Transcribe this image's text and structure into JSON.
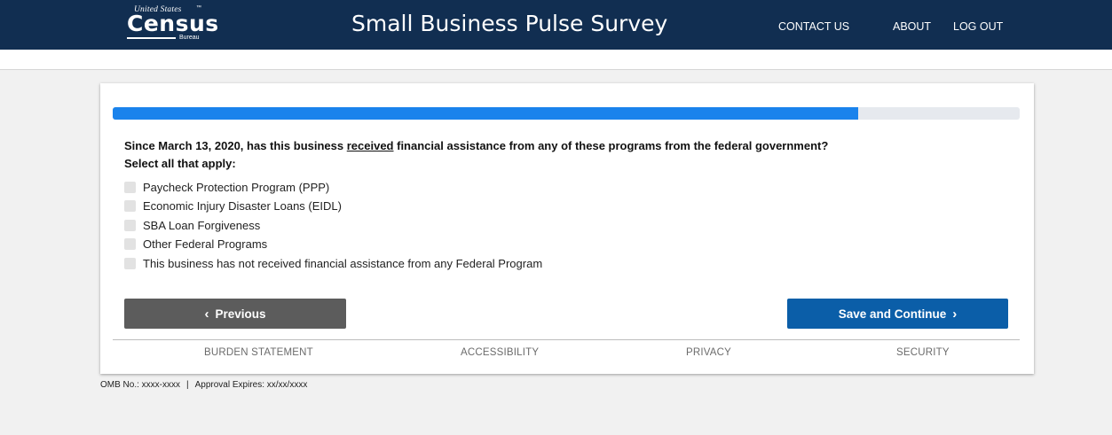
{
  "header": {
    "logo": {
      "top": "United States",
      "tm": "™",
      "main": "Census",
      "bottom": "Bureau"
    },
    "title": "Small Business Pulse Survey",
    "nav": [
      "CONTACT US",
      "ABOUT",
      "LOG OUT"
    ]
  },
  "progress": {
    "fraction": 0.822
  },
  "question": {
    "text_before": "Since March 13, 2020, has this business ",
    "emphasis": "received",
    "text_after": " financial assistance from any of these programs from the federal government?",
    "instruction": "Select all that apply:"
  },
  "options": [
    {
      "label": "Paycheck Protection Program (PPP)",
      "checked": false
    },
    {
      "label": "Economic Injury Disaster Loans (EIDL)",
      "checked": false
    },
    {
      "label": "SBA Loan Forgiveness",
      "checked": false
    },
    {
      "label": "Other Federal Programs",
      "checked": false
    },
    {
      "label": "This business has not received financial assistance from any Federal Program",
      "checked": false
    }
  ],
  "buttons": {
    "previous": "Previous",
    "next": "Save and Continue"
  },
  "footer": {
    "links": [
      "BURDEN STATEMENT",
      "ACCESSIBILITY",
      "PRIVACY",
      "SECURITY"
    ]
  },
  "omb": {
    "number": "OMB No.: xxxx-xxxx",
    "separator": "|",
    "expires": "Approval Expires: xx/xx/xxxx"
  },
  "colors": {
    "header_bg": "#112e51",
    "progress_fill": "#1a83ec",
    "progress_track": "#e6e9ee",
    "primary_button": "#0b5ea8",
    "secondary_button": "#5c5c5c"
  }
}
